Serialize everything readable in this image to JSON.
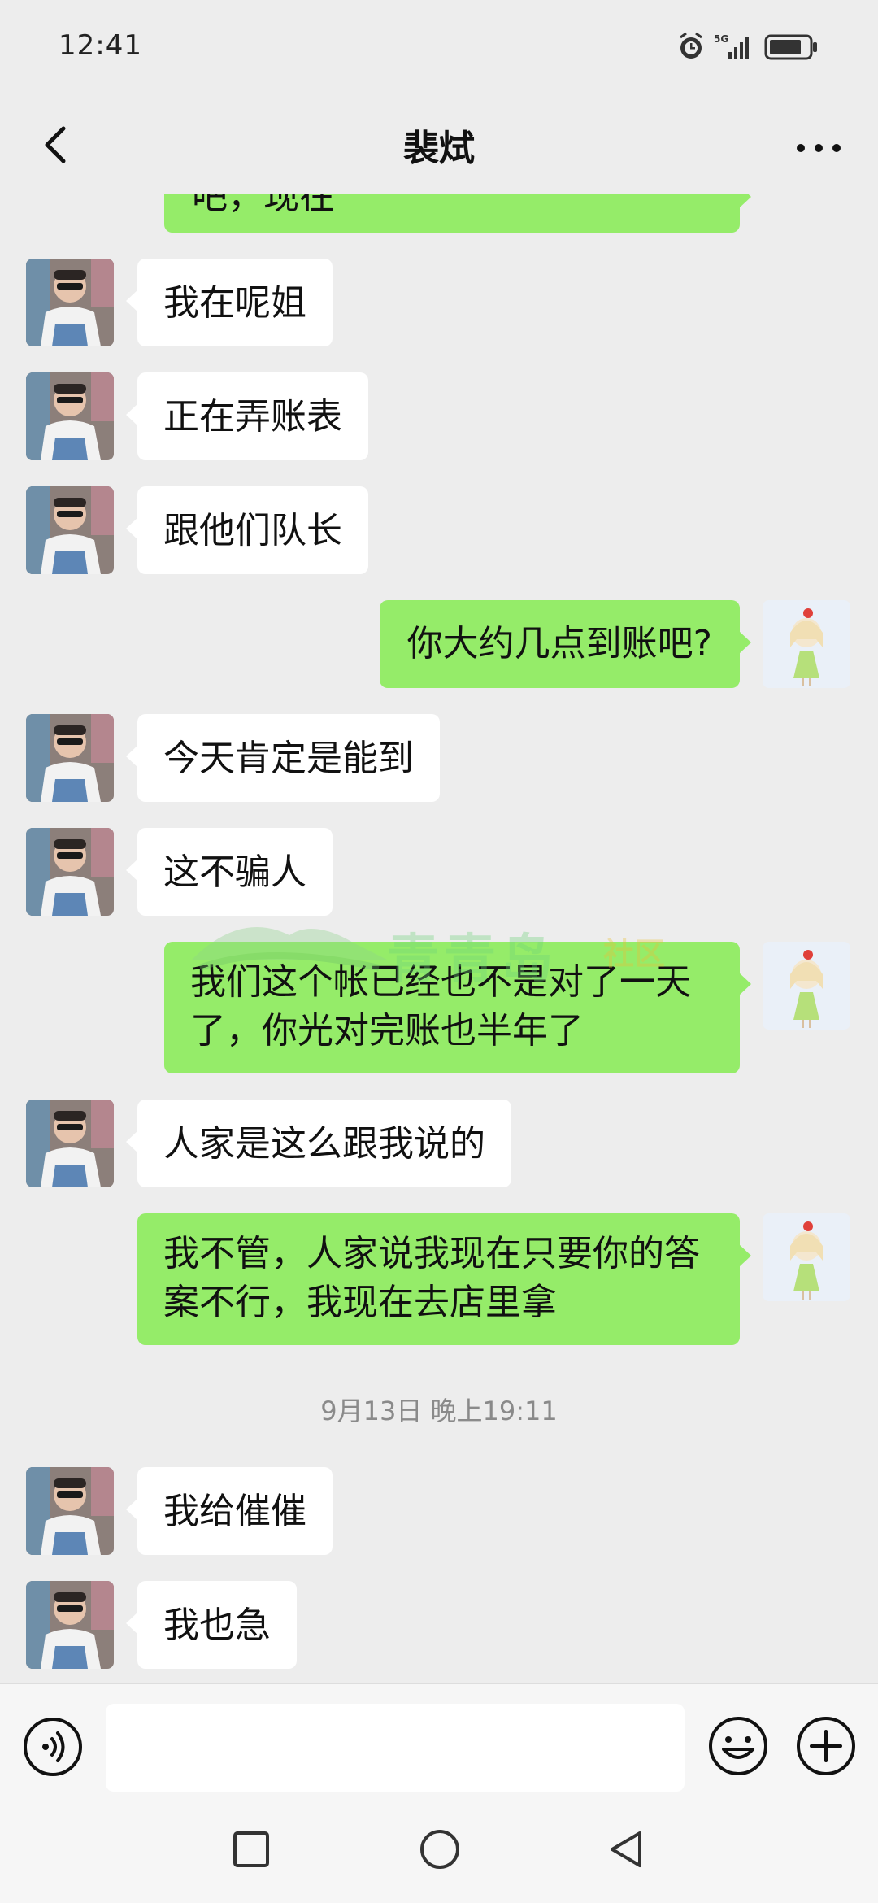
{
  "status_bar": {
    "time": "12:41",
    "network": "5G",
    "icons": [
      "alarm-icon",
      "signal-icon",
      "battery-icon"
    ]
  },
  "header": {
    "title": "裴烒",
    "back_icon": "chevron-left-icon",
    "more_icon": "more-dots-icon"
  },
  "messages": [
    {
      "side": "out",
      "text": "吧，现在",
      "partial": true
    },
    {
      "side": "in",
      "text": "我在呢姐"
    },
    {
      "side": "in",
      "text": "正在弄账表"
    },
    {
      "side": "in",
      "text": "跟他们队长"
    },
    {
      "side": "out",
      "text": "你大约几点到账吧?"
    },
    {
      "side": "in",
      "text": "今天肯定是能到"
    },
    {
      "side": "in",
      "text": "这不骗人"
    },
    {
      "side": "out",
      "text": "我们这个帐已经也不是对了一天了，你光对完账也半年了"
    },
    {
      "side": "in",
      "text": "人家是这么跟我说的"
    },
    {
      "side": "out",
      "text": "我不管，人家说我现在只要你的答案不行，我现在去店里拿"
    },
    {
      "side": "in",
      "text": "我给催催"
    },
    {
      "side": "in",
      "text": "我也急"
    }
  ],
  "timestamp": "9月13日 晚上19:11",
  "watermark": {
    "text": "青青岛",
    "sub": "社区"
  },
  "input_bar": {
    "value": "",
    "placeholder": "",
    "icons": [
      "voice-icon",
      "emoji-icon",
      "plus-icon"
    ]
  },
  "nav_bar": {
    "icons": [
      "recent-apps-icon",
      "home-icon",
      "back-icon"
    ]
  },
  "colors": {
    "background": "#ededed",
    "outgoing_bubble": "#95ec69",
    "incoming_bubble": "#ffffff",
    "timestamp_text": "#8a8a8a"
  }
}
